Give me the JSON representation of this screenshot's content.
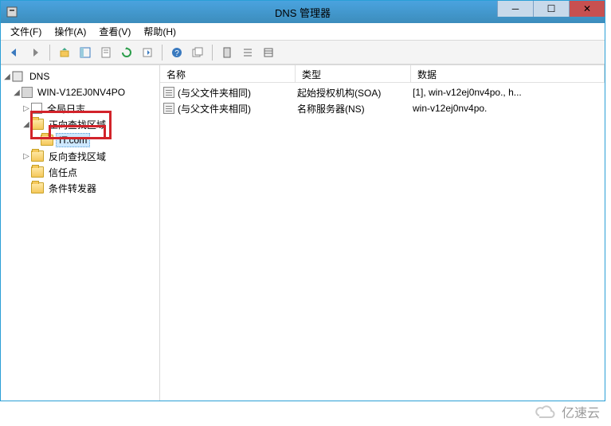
{
  "title": "DNS 管理器",
  "menubar": {
    "file": "文件(F)",
    "action": "操作(A)",
    "view": "查看(V)",
    "help": "帮助(H)"
  },
  "tree": {
    "root": "DNS",
    "server": "WIN-V12EJ0NV4PO",
    "nodes": {
      "global_log": "全局日志",
      "forward_zone": "正向查找区域",
      "zone_it": "IT.com",
      "reverse_zone": "反向查找区域",
      "trust_points": "信任点",
      "conditional_forwarders": "条件转发器"
    }
  },
  "columns": {
    "name": "名称",
    "type": "类型",
    "data": "数据"
  },
  "records": [
    {
      "name": "(与父文件夹相同)",
      "type": "起始授权机构(SOA)",
      "data": "[1], win-v12ej0nv4po., h..."
    },
    {
      "name": "(与父文件夹相同)",
      "type": "名称服务器(NS)",
      "data": "win-v12ej0nv4po."
    }
  ],
  "watermark": "亿速云"
}
